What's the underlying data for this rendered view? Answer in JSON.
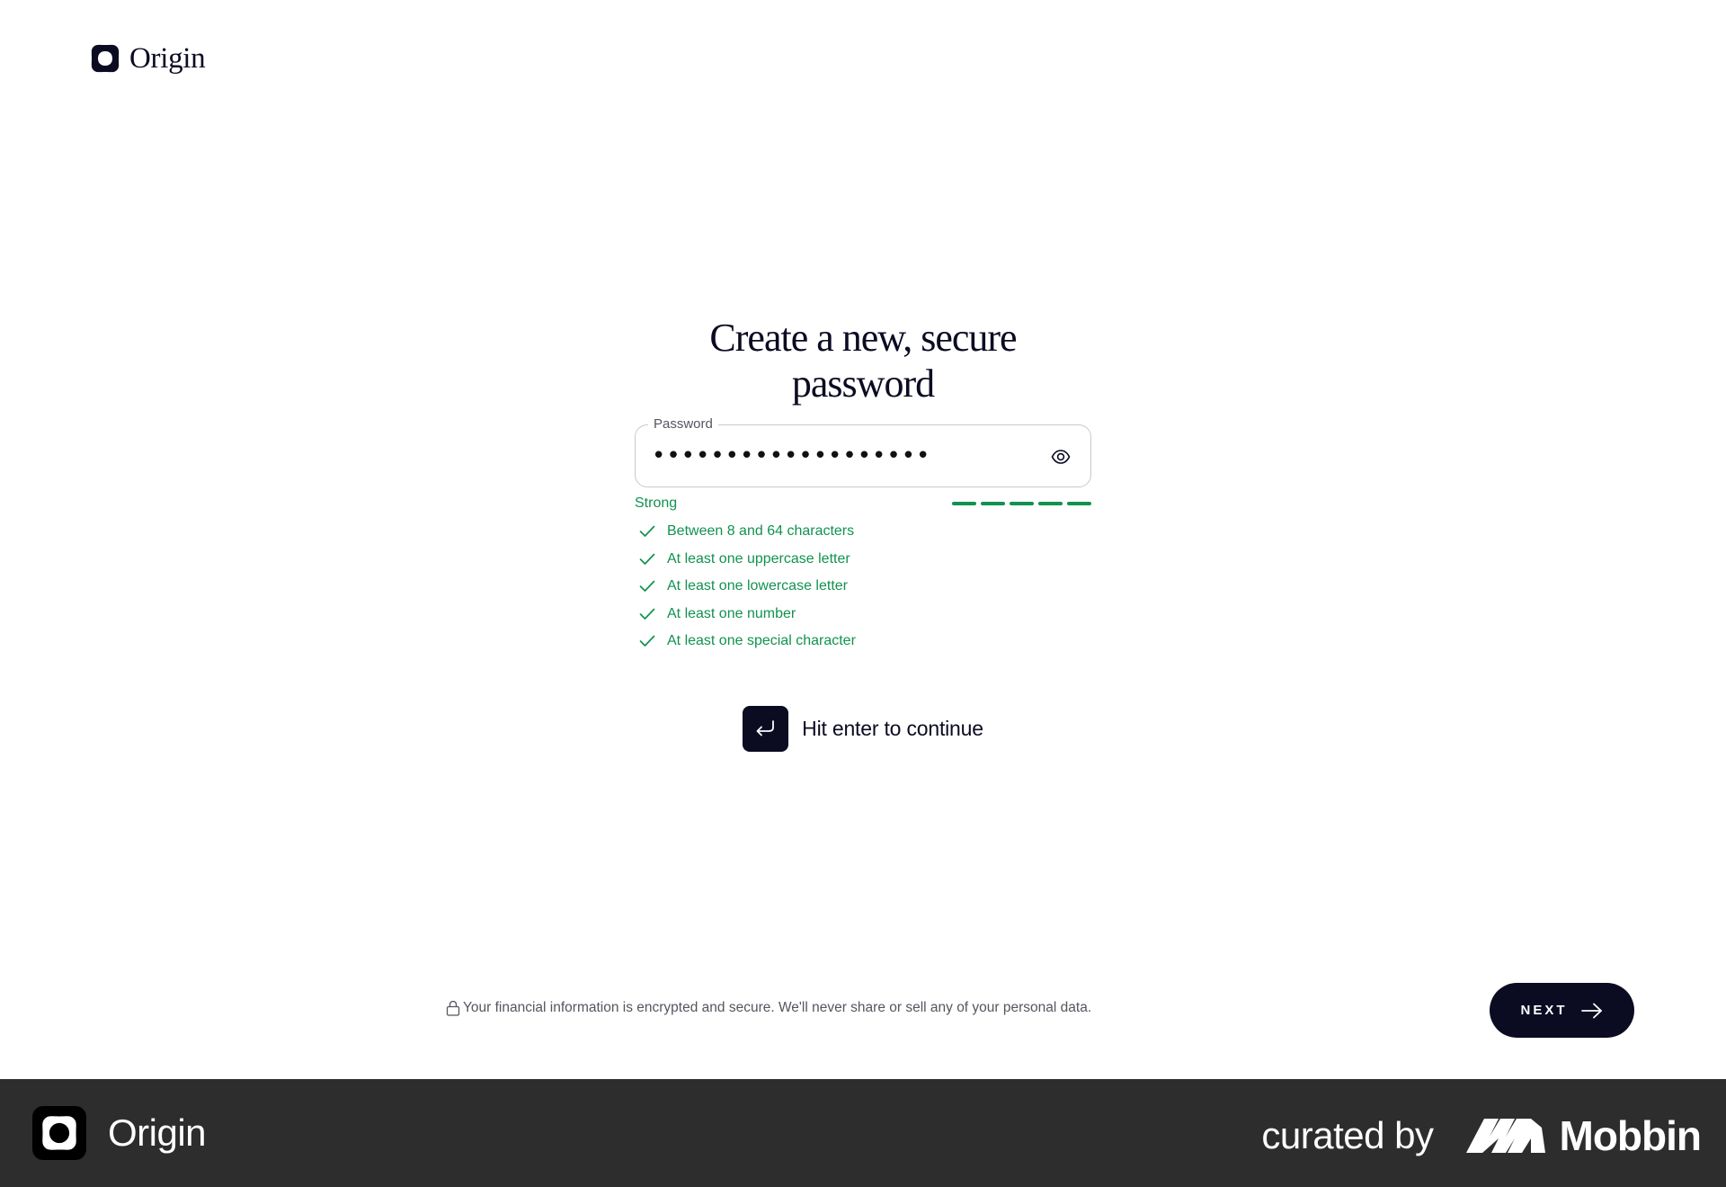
{
  "app": {
    "brand": "Origin"
  },
  "page": {
    "title": "Create a new, secure password"
  },
  "password_field": {
    "label": "Password",
    "value": "•••••••••••••••••••",
    "toggle_icon": "eye-icon"
  },
  "strength": {
    "label": "Strong",
    "filled_segments": 5,
    "total_segments": 5,
    "color": "#12924f"
  },
  "requirements": [
    {
      "text": "Between 8 and 64 characters",
      "met": true
    },
    {
      "text": "At least one uppercase letter",
      "met": true
    },
    {
      "text": "At least one lowercase letter",
      "met": true
    },
    {
      "text": "At least one number",
      "met": true
    },
    {
      "text": "At least one special character",
      "met": true
    }
  ],
  "enter_hint": {
    "text": "Hit enter to continue",
    "icon": "enter-key-icon"
  },
  "security_note": {
    "text": "Your financial information is encrypted and secure. We'll never share or sell any of your personal data.",
    "icon": "lock-icon"
  },
  "next_button": {
    "label": "NEXT",
    "icon": "arrow-right-icon"
  },
  "footer": {
    "app_name": "Origin",
    "curated_by": "curated by",
    "curator": "Mobbin"
  },
  "colors": {
    "ink": "#0b0b22",
    "success": "#12924f",
    "footer_bg": "#2d2d2d"
  }
}
